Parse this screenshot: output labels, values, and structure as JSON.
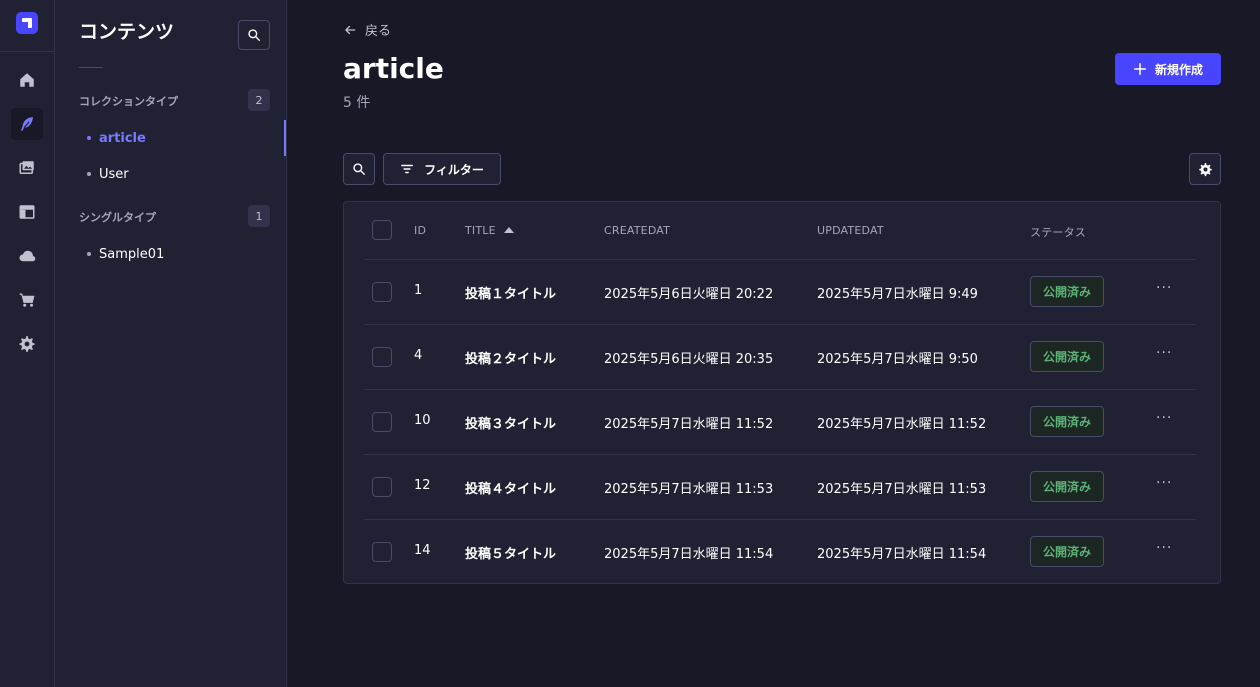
{
  "rail": {
    "items": [
      {
        "icon": "home-icon"
      },
      {
        "icon": "feather-icon",
        "active": true
      },
      {
        "icon": "images-icon"
      },
      {
        "icon": "layout-icon"
      },
      {
        "icon": "cloud-icon"
      },
      {
        "icon": "cart-icon"
      },
      {
        "icon": "gear-icon"
      }
    ]
  },
  "subnav": {
    "title": "コンテンツ",
    "sections": [
      {
        "label": "コレクションタイプ",
        "count": "2",
        "items": [
          "article",
          "User"
        ]
      },
      {
        "label": "シングルタイプ",
        "count": "1",
        "items": [
          "Sample01"
        ]
      }
    ],
    "active_item": "article"
  },
  "header": {
    "back_label": "戻る",
    "title": "article",
    "subtitle": "5 件",
    "create_label": "新規作成"
  },
  "toolbar": {
    "filter_label": "フィルター"
  },
  "table": {
    "columns": [
      "ID",
      "TITLE",
      "CREATEDAT",
      "UPDATEDAT",
      "ステータス"
    ],
    "rows": [
      {
        "id": "1",
        "title": "投稿１タイトル",
        "created": "2025年5月6日火曜日 20:22",
        "updated": "2025年5月7日水曜日 9:49",
        "status": "公開済み"
      },
      {
        "id": "4",
        "title": "投稿２タイトル",
        "created": "2025年5月6日火曜日 20:35",
        "updated": "2025年5月7日水曜日 9:50",
        "status": "公開済み"
      },
      {
        "id": "10",
        "title": "投稿３タイトル",
        "created": "2025年5月7日水曜日 11:52",
        "updated": "2025年5月7日水曜日 11:52",
        "status": "公開済み"
      },
      {
        "id": "12",
        "title": "投稿４タイトル",
        "created": "2025年5月7日水曜日 11:53",
        "updated": "2025年5月7日水曜日 11:53",
        "status": "公開済み"
      },
      {
        "id": "14",
        "title": "投稿５タイトル",
        "created": "2025年5月7日水曜日 11:54",
        "updated": "2025年5月7日水曜日 11:54",
        "status": "公開済み"
      }
    ],
    "more_label": "···"
  },
  "colors": {
    "accent": "#4945ff",
    "active_link": "#7b79ff",
    "status_green": "#5cb176",
    "background": "#181826",
    "panel": "#212134"
  }
}
